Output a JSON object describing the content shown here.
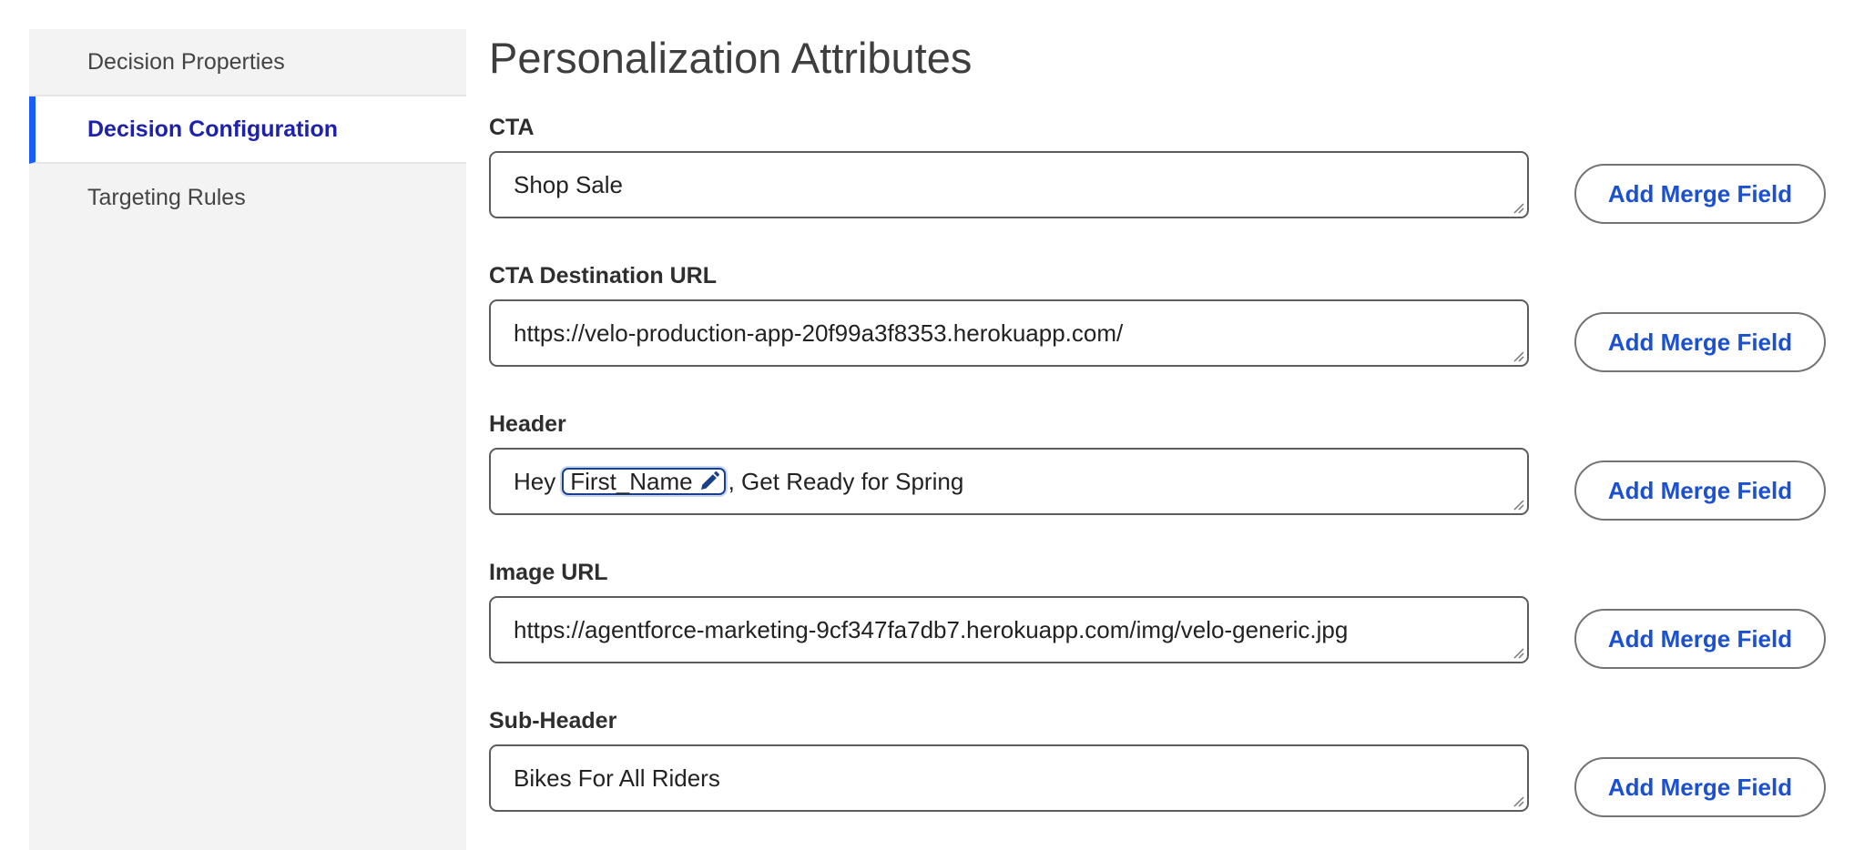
{
  "sidebar": {
    "items": [
      {
        "label": "Decision Properties",
        "active": false
      },
      {
        "label": "Decision Configuration",
        "active": true
      },
      {
        "label": "Targeting Rules",
        "active": false
      }
    ]
  },
  "main": {
    "title": "Personalization Attributes",
    "merge_button_label": "Add Merge Field",
    "fields": [
      {
        "label": "CTA",
        "value": "Shop Sale"
      },
      {
        "label": "CTA Destination URL",
        "value": "https://velo-production-app-20f99a3f8353.herokuapp.com/"
      },
      {
        "label": "Header",
        "value_prefix": "Hey",
        "merge_token": "First_Name",
        "value_suffix": ", Get Ready for Spring"
      },
      {
        "label": "Image URL",
        "value": "https://agentforce-marketing-9cf347fa7db7.herokuapp.com/img/velo-generic.jpg"
      },
      {
        "label": "Sub-Header",
        "value": "Bikes For All Riders"
      }
    ]
  },
  "colors": {
    "accent": "#1b5cff",
    "active_text": "#1e22aa",
    "button_text": "#1b50d0"
  }
}
